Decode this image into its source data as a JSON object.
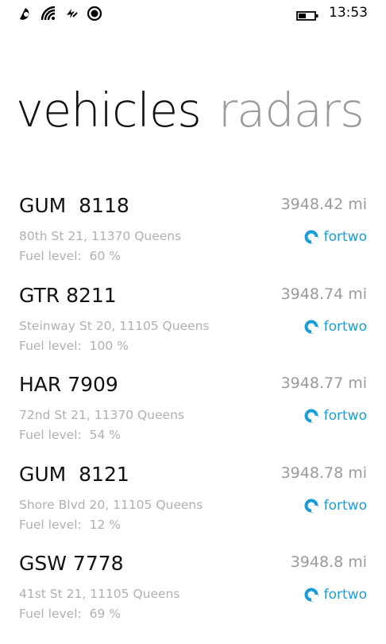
{
  "status_bar": {
    "time": "13:53",
    "icons": [
      "notification-icon",
      "wifi-icon",
      "data-connection-icon",
      "location-icon",
      "battery-icon"
    ],
    "battery_level": 0.45
  },
  "pivot": {
    "items": [
      {
        "label": "vehicles",
        "active": true
      },
      {
        "label": "radars",
        "active": false
      }
    ]
  },
  "vehicles": [
    {
      "plate": "GUM  8118",
      "distance": "3948.42 mi",
      "address": "80th St 21, 11370 Queens",
      "fuel": "Fuel level:  60 %",
      "model": "fortwo"
    },
    {
      "plate": "GTR 8211",
      "distance": "3948.74 mi",
      "address": "Steinway St 20, 11105 Queens",
      "fuel": "Fuel level:  100 %",
      "model": "fortwo"
    },
    {
      "plate": "HAR 7909",
      "distance": "3948.77 mi",
      "address": "72nd St 21, 11370 Queens",
      "fuel": "Fuel level:  54 %",
      "model": "fortwo"
    },
    {
      "plate": "GUM  8121",
      "distance": "3948.78 mi",
      "address": "Shore Blvd 20, 11105 Queens",
      "fuel": "Fuel level:  12 %",
      "model": "fortwo"
    },
    {
      "plate": "GSW 7778",
      "distance": "3948.8 mi",
      "address": "41st St 21, 11105 Queens",
      "fuel": "Fuel level:  69 %",
      "model": "fortwo"
    }
  ],
  "colors": {
    "accent": "#1a9ed9",
    "primary_text": "#111111",
    "secondary_text": "#b0b0b0",
    "inactive_pivot": "#9a9a9a"
  }
}
